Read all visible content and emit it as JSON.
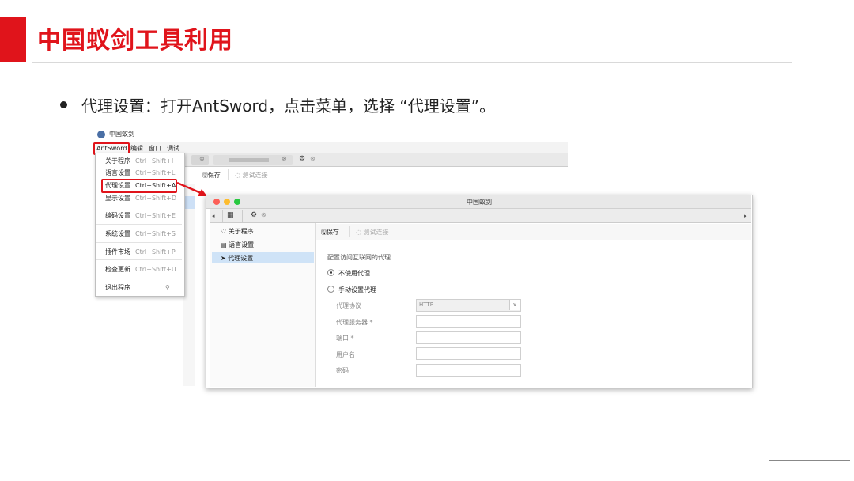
{
  "slide": {
    "title": "中国蚁剑工具利用",
    "bullet": "代理设置：打开AntSword，点击菜单，选择 “代理设置”。"
  },
  "back_window": {
    "title": "中国蚁剑",
    "menu": [
      "AntSword",
      "编辑",
      "窗口",
      "调试"
    ],
    "save_label": "保存",
    "test_label": "测试连接",
    "dropdown": [
      {
        "label": "关于程序",
        "shortcut": "Ctrl+Shift+I"
      },
      {
        "label": "语言设置",
        "shortcut": "Ctrl+Shift+L"
      },
      {
        "label": "代理设置",
        "shortcut": "Ctrl+Shift+A"
      },
      {
        "label": "显示设置",
        "shortcut": "Ctrl+Shift+D"
      },
      {
        "label": "编码设置",
        "shortcut": "Ctrl+Shift+E"
      },
      {
        "label": "系统设置",
        "shortcut": "Ctrl+Shift+S"
      },
      {
        "label": "插件市场",
        "shortcut": "Ctrl+Shift+P"
      },
      {
        "label": "检查更新",
        "shortcut": "Ctrl+Shift+U"
      },
      {
        "label": "退出程序",
        "shortcut": ""
      }
    ]
  },
  "front_window": {
    "title": "中国蚁剑",
    "sidebar": [
      "关于程序",
      "语言设置",
      "代理设置"
    ],
    "save_label": "保存",
    "test_label": "测试连接",
    "section_title": "配置访问互联网的代理",
    "radio_no_proxy": "不使用代理",
    "radio_manual": "手动设置代理",
    "fields": {
      "protocol_label": "代理协议",
      "protocol_value": "HTTP",
      "server_label": "代理服务器 *",
      "port_label": "端口 *",
      "user_label": "用户名",
      "password_label": "密码"
    }
  },
  "colors": {
    "accent": "#e0141b",
    "selection": "#cfe3f7",
    "mac_red": "#fc5f57",
    "mac_yellow": "#fdbc2e",
    "mac_green": "#28c840"
  }
}
